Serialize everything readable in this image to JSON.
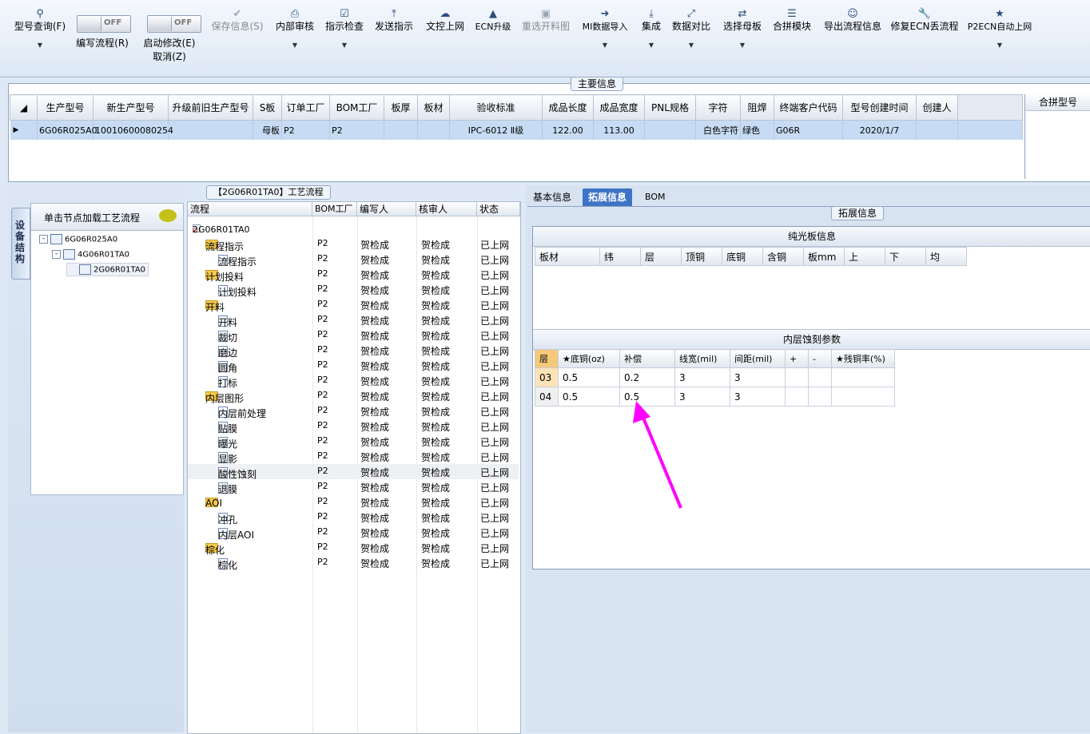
{
  "toolbar": {
    "items": [
      {
        "label": "型号查询(F)",
        "icon": "search-icon",
        "dropdown": true
      },
      {
        "label": "保存信息(S)",
        "icon": "check-icon",
        "disabled": true
      },
      {
        "label": "内部审核",
        "icon": "printer-icon",
        "dropdown": true
      },
      {
        "label": "指示检查",
        "icon": "checkbox-icon",
        "dropdown": true
      },
      {
        "label": "发送指示",
        "icon": "upload-icon"
      },
      {
        "label": "文控上网",
        "icon": "cloud-upload-icon"
      },
      {
        "label": "ECN升级",
        "icon": "road-icon"
      },
      {
        "label": "重选开料图",
        "icon": "picture-icon",
        "disabled": true
      },
      {
        "label": "MI数据导入",
        "icon": "login-icon",
        "dropdown": true
      },
      {
        "label": "集成",
        "icon": "download-icon",
        "dropdown": true
      },
      {
        "label": "数据对比",
        "icon": "compress-icon",
        "dropdown": true
      },
      {
        "label": "选择母板",
        "icon": "shuffle-icon",
        "dropdown": true
      },
      {
        "label": "合拼模块",
        "icon": "list-icon"
      },
      {
        "label": "导出流程信息",
        "icon": "smile-icon"
      },
      {
        "label": "修复ECN丢流程",
        "icon": "wrench-icon"
      },
      {
        "label": "P2ECN自动上网",
        "icon": "star-icon",
        "dropdown": true
      }
    ],
    "toggle_write": {
      "state": "OFF",
      "label": "编写流程(R)"
    },
    "toggle_modify": {
      "state": "OFF",
      "label1": "启动修改(E)",
      "label2": "取消(Z)"
    }
  },
  "main_info": {
    "title": "主要信息",
    "columns": [
      "生产型号",
      "新生产型号",
      "升级前旧生产型号",
      "S板",
      "订单工厂",
      "BOM工厂",
      "板厚",
      "板材",
      "验收标准",
      "成品长度",
      "成品宽度",
      "PNL规格",
      "字符",
      "阻焊",
      "终端客户代码",
      "型号创建时间",
      "创建人"
    ],
    "row": [
      "6G06R025A0",
      "10010600080254",
      "",
      "母板",
      "P2",
      "P2",
      "",
      "",
      "IPC-6012 Ⅱ级",
      "122.00",
      "113.00",
      "",
      "白色字符",
      "绿色",
      "G06R",
      "2020/1/7",
      ""
    ]
  },
  "merge_panel": {
    "title": "合拼型号"
  },
  "device_tab": "设备结构",
  "tree": {
    "header": "单击节点加载工艺流程",
    "nodes": [
      "6G06R025A0",
      "4G06R01TA0",
      "2G06R01TA0"
    ]
  },
  "process": {
    "title": "【2G06R01TA0】工艺流程",
    "columns": [
      "流程",
      "BOM工厂",
      "编写人",
      "核审人",
      "状态"
    ],
    "root": "2G06R01TA0",
    "rows": [
      {
        "name": "流程指示",
        "group": true
      },
      {
        "name": "流程指示",
        "group": false
      },
      {
        "name": "计划投料",
        "group": true
      },
      {
        "name": "计划投料",
        "group": false
      },
      {
        "name": "开料",
        "group": true
      },
      {
        "name": "开料",
        "group": false
      },
      {
        "name": "裁切",
        "group": false
      },
      {
        "name": "磨边",
        "group": false
      },
      {
        "name": "圆角",
        "group": false
      },
      {
        "name": "打标",
        "group": false
      },
      {
        "name": "内层图形",
        "group": true
      },
      {
        "name": "内层前处理",
        "group": false
      },
      {
        "name": "贴膜",
        "group": false
      },
      {
        "name": "曝光",
        "group": false
      },
      {
        "name": "显影",
        "group": false
      },
      {
        "name": "酸性蚀刻",
        "group": false,
        "selected": true
      },
      {
        "name": "退膜",
        "group": false
      },
      {
        "name": "AOI",
        "group": true
      },
      {
        "name": "冲孔",
        "group": false
      },
      {
        "name": "内层AOI",
        "group": false
      },
      {
        "name": "棕化",
        "group": true
      },
      {
        "name": "棕化",
        "group": false
      }
    ],
    "bom": "P2",
    "writer": "贺检成",
    "reviewer": "贺检成",
    "status": "已上网"
  },
  "right": {
    "tabs": [
      "基本信息",
      "拓展信息",
      "BOM"
    ],
    "active": 1,
    "section_title": "拓展信息",
    "plain_title": "纯光板信息",
    "plain_columns": [
      "板材",
      "纬",
      "层",
      "顶铜",
      "底铜",
      "含铜",
      "板mm",
      "上",
      "下",
      "均"
    ],
    "etch_title": "内层蚀刻参数",
    "etch_columns": [
      "层",
      "★底铜(oz)",
      "补偿",
      "线宽(mil)",
      "间距(mil)",
      "+",
      "-",
      "★残铜率(%)"
    ],
    "etch_rows": [
      [
        "03",
        "0.5",
        "0.2",
        "3",
        "3",
        "",
        "",
        ""
      ],
      [
        "04",
        "0.5",
        "0.5",
        "3",
        "3",
        "",
        "",
        ""
      ]
    ],
    "arrow_color": "#ff00ff"
  }
}
